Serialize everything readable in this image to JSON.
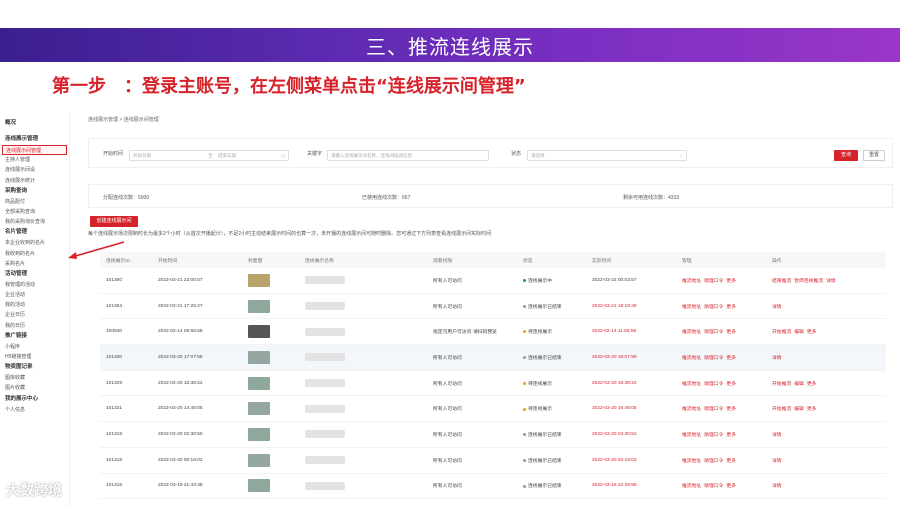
{
  "banner": {
    "title": "三、推流连线展示"
  },
  "step": {
    "text": "第一步　：登录主账号，在左侧菜单点击“连线展示间管理”"
  },
  "sidebar": {
    "top": "概况",
    "groups": [
      {
        "title": "连线展示管理",
        "items": [
          "连线展示间管理",
          "主持人管理",
          "连线展示间设",
          "连线展示统计"
        ]
      },
      {
        "title": "采购查询",
        "items": [
          "商品配付",
          "全部采购查询",
          "我的采购询价查询"
        ]
      },
      {
        "title": "名片管理",
        "items": [
          "本企业收到的名片",
          "我收到的名片",
          "采购名片"
        ]
      },
      {
        "title": "活动管理",
        "items": [
          "我管理的活动",
          "企业活动",
          "我的活动",
          "企业日历",
          "我的日历"
        ]
      },
      {
        "title": "推广链接",
        "items": [
          "小程序",
          "H5链接管理"
        ]
      },
      {
        "title": "物资图记录",
        "items": [
          "图库收藏",
          "图片收藏"
        ]
      },
      {
        "title": "我的展示中心",
        "items": [
          "个人信息"
        ]
      }
    ]
  },
  "breadcrumb": "连线展示管理 > 连线展示间管理",
  "filters": {
    "start_label": "开始时间",
    "start_placeholder": "开始日期",
    "to": "至",
    "end_placeholder": "结束日期",
    "keyword_label": "关键字",
    "keyword_placeholder": "请输入连线展示间名称、连线间描述信息",
    "status_label": "状态",
    "status_placeholder": "请选择",
    "search_btn": "查询",
    "reset_btn": "重置"
  },
  "stats": {
    "assigned": "分配连线次数：5000",
    "used": "已使用连线次数：667",
    "remaining": "剩余可用连线次数：4333"
  },
  "create_btn": "创建连线展示间",
  "notice": "每个连线展示场次限制时长为最多2个小时（从首次开播起计），不足2小时主动结束展示时间的也算一次，未开播的连线展示间可随时删除。您可通过下方列表查看连线展示间实际时间",
  "table": {
    "headers": [
      "连线展示ID",
      "开始时间",
      "封面图",
      "连线展示名称",
      "观看权限",
      "状态",
      "实际时间",
      "管理",
      "操作"
    ],
    "rows": [
      {
        "id": "101360",
        "start": "2022-03-21 22:00:57",
        "perm": "所有人可访问",
        "status": "连线展示中",
        "status_color": "#1e9c4a",
        "actual": "2022-03-22 00:03:57",
        "actual_red": false,
        "manage": [
          "推流地址",
          "助理口令",
          "更多"
        ],
        "ops": [
          "结束推流",
          "暂停连线推流",
          "详情"
        ],
        "thumb": "#b8a46a",
        "hl": false
      },
      {
        "id": "101353",
        "start": "2022-03-21 17:25:27",
        "perm": "所有人可访问",
        "status": "连线展示已结束",
        "status_color": "#999999",
        "actual": "2022-03-21 18:18:49",
        "actual_red": true,
        "manage": [
          "推流地址",
          "助理口令",
          "更多"
        ],
        "ops": [
          "详情"
        ],
        "thumb": "#8fa89c",
        "hl": false
      },
      {
        "id": "100940",
        "start": "2022-02-14 09:56:58",
        "perm": "指定可用户可访问·请扫码预览",
        "status": "待连线展示",
        "status_color": "#e8a21a",
        "actual": "2022-02-14 11:56:58",
        "actual_red": true,
        "manage": [
          "推流地址",
          "助理口令",
          "更多"
        ],
        "ops": [
          "开始推流",
          "编辑",
          "更多"
        ],
        "thumb": "#555555",
        "hl": false
      },
      {
        "id": "101330",
        "start": "2022-03-20 17:07:58",
        "perm": "所有人可访问",
        "status": "连线展示已结束",
        "status_color": "#999999",
        "actual": "2022-03-20 19:07:59",
        "actual_red": true,
        "manage": [
          "推流地址",
          "助理口令",
          "更多"
        ],
        "ops": [
          "详情"
        ],
        "thumb": "#93a6a0",
        "hl": true
      },
      {
        "id": "101329",
        "start": "2022-03-20 16:38:22",
        "perm": "所有人可访问",
        "status": "待连线展示",
        "status_color": "#e8a21a",
        "actual": "2022-03-20 18:38:22",
        "actual_red": true,
        "manage": [
          "推流地址",
          "助理口令",
          "更多"
        ],
        "ops": [
          "开始推流",
          "编辑",
          "更多"
        ],
        "thumb": "#8fa89c",
        "hl": false
      },
      {
        "id": "101321",
        "start": "2022-03-20 14:48:05",
        "perm": "所有人可访问",
        "status": "待连线展示",
        "status_color": "#e8a21a",
        "actual": "2022-03-20 16:48:05",
        "actual_red": true,
        "manage": [
          "推流地址",
          "助理口令",
          "更多"
        ],
        "ops": [
          "开始推流",
          "编辑",
          "更多"
        ],
        "thumb": "#93a6a0",
        "hl": false
      },
      {
        "id": "101319",
        "start": "2022-03-20 02:30:50",
        "perm": "所有人可访问",
        "status": "连线展示已结束",
        "status_color": "#999999",
        "actual": "2022-03-20 04:30:52",
        "actual_red": true,
        "manage": [
          "推流地址",
          "助理口令",
          "更多"
        ],
        "ops": [
          "详情"
        ],
        "thumb": "#8fa89c",
        "hl": false
      },
      {
        "id": "101318",
        "start": "2022-03-20 00:18:02",
        "perm": "所有人可访问",
        "status": "连线展示已结束",
        "status_color": "#999999",
        "actual": "2022-03-20 02:18:03",
        "actual_red": true,
        "manage": [
          "推流地址",
          "助理口令",
          "更多"
        ],
        "ops": [
          "详情"
        ],
        "thumb": "#93a6a0",
        "hl": false
      },
      {
        "id": "101316",
        "start": "2022-03-19 21:43:38",
        "perm": "所有人可访问",
        "status": "连线展示已结束",
        "status_color": "#999999",
        "actual": "2022-03-19 22:28:58",
        "actual_red": true,
        "manage": [
          "推流地址",
          "助理口令",
          "更多"
        ],
        "ops": [
          "详情"
        ],
        "thumb": "#8fa89c",
        "hl": false
      }
    ]
  },
  "watermark": "大数跨境"
}
